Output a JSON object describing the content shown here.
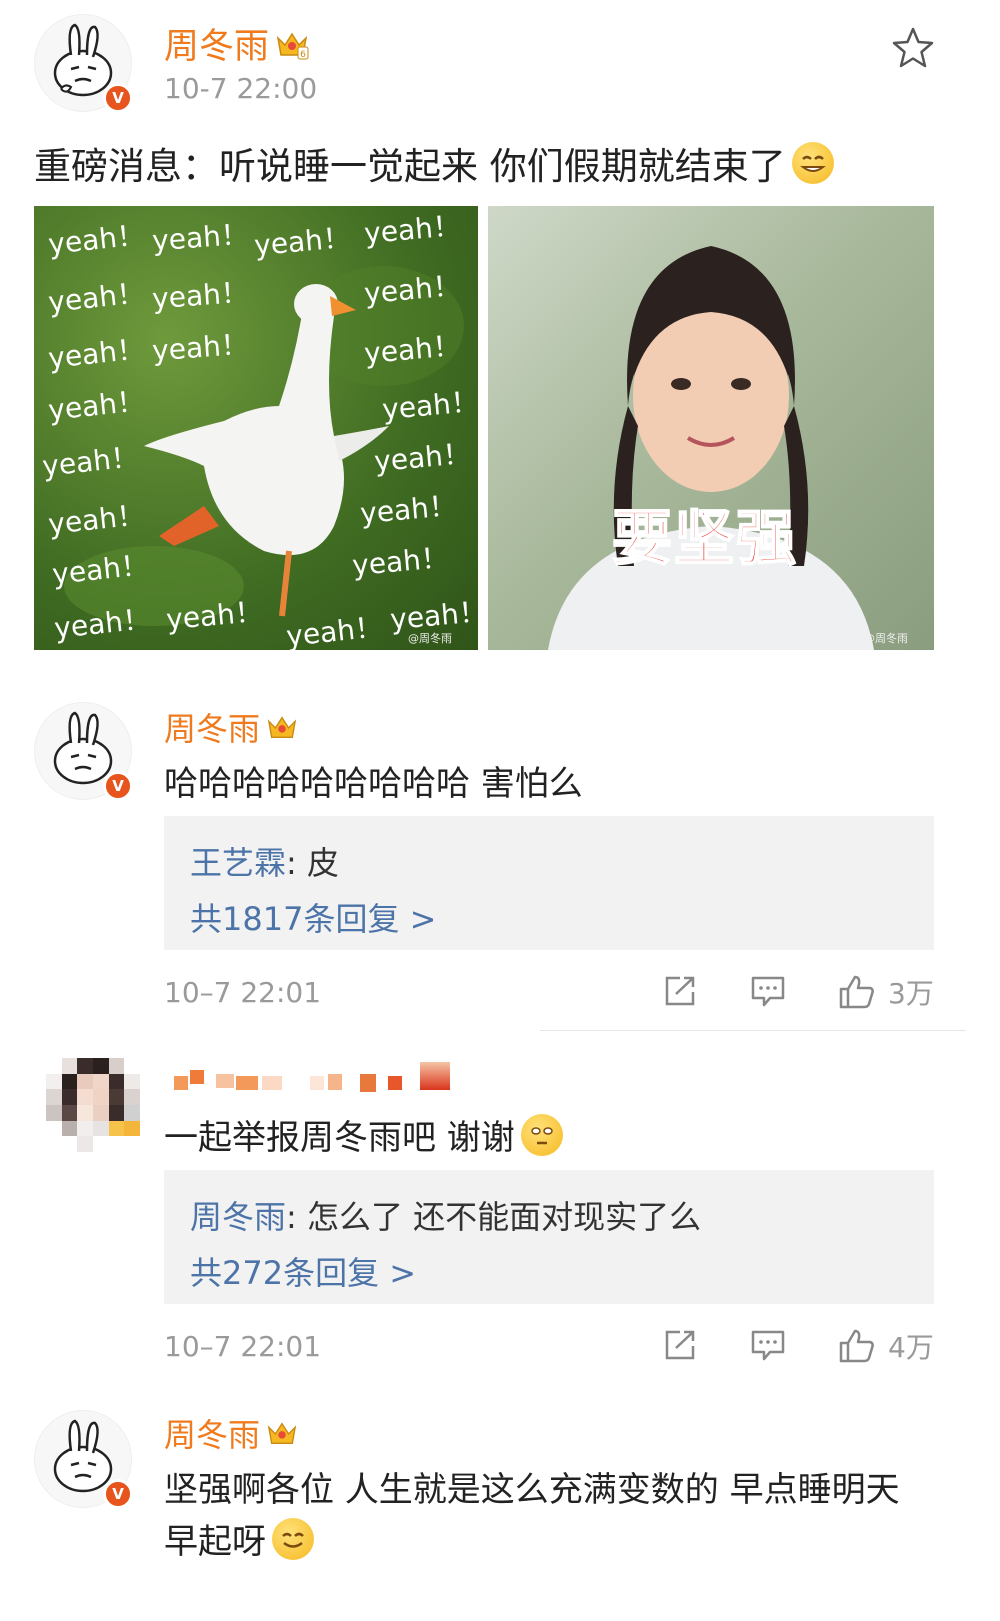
{
  "post": {
    "username": "周冬雨",
    "time": "10-7 22:00",
    "text": "重磅消息：听说睡一觉起来 你们假期就结束了",
    "verified_badge": "V",
    "image1": {
      "words": [
        "yeah！",
        "yeah！",
        "yeah！",
        "yeah！",
        "yeah！",
        "yeah！",
        "yeah！",
        "yeah！",
        "yeah！",
        "yeah！",
        "yeah！",
        "yeah！",
        "yeah！",
        "yeah！",
        "yeah！",
        "yeah！",
        "yeah！",
        "yeah！",
        "yeah！",
        "yeah！",
        "yeah！",
        "yeah！"
      ],
      "watermark": "@周冬雨"
    },
    "image2": {
      "caption": "要坚强",
      "watermark": "@周冬雨"
    }
  },
  "comments": [
    {
      "username": "周冬雨",
      "text": "哈哈哈哈哈哈哈哈哈 害怕么",
      "reply_name": "王艺霖",
      "reply_text": ": 皮",
      "reply_count": "共1817条回复 >",
      "time": "10–7 22:01",
      "likes": "3万"
    },
    {
      "username": "",
      "text": "一起举报周冬雨吧 谢谢",
      "reply_name": "周冬雨",
      "reply_text": ": 怎么了 还不能面对现实了么",
      "reply_count": "共272条回复 >",
      "time": "10–7 22:01",
      "likes": "4万"
    },
    {
      "username": "周冬雨",
      "text_line1": "坚强啊各位 人生就是这么充满变数的 早点睡明天",
      "text_line2": "早起呀"
    }
  ],
  "icons": {
    "favorite": "star-icon",
    "share": "share-icon",
    "comment": "comment-icon",
    "like": "thumbs-up-icon",
    "crown": "crown-badge-icon",
    "emoji": "smiley-emoji-icon"
  },
  "colors": {
    "username": "#f07b1f",
    "reply_link": "#4d74a8",
    "meta_gray": "#9a9a9a",
    "reply_bg": "#f2f2f2"
  }
}
